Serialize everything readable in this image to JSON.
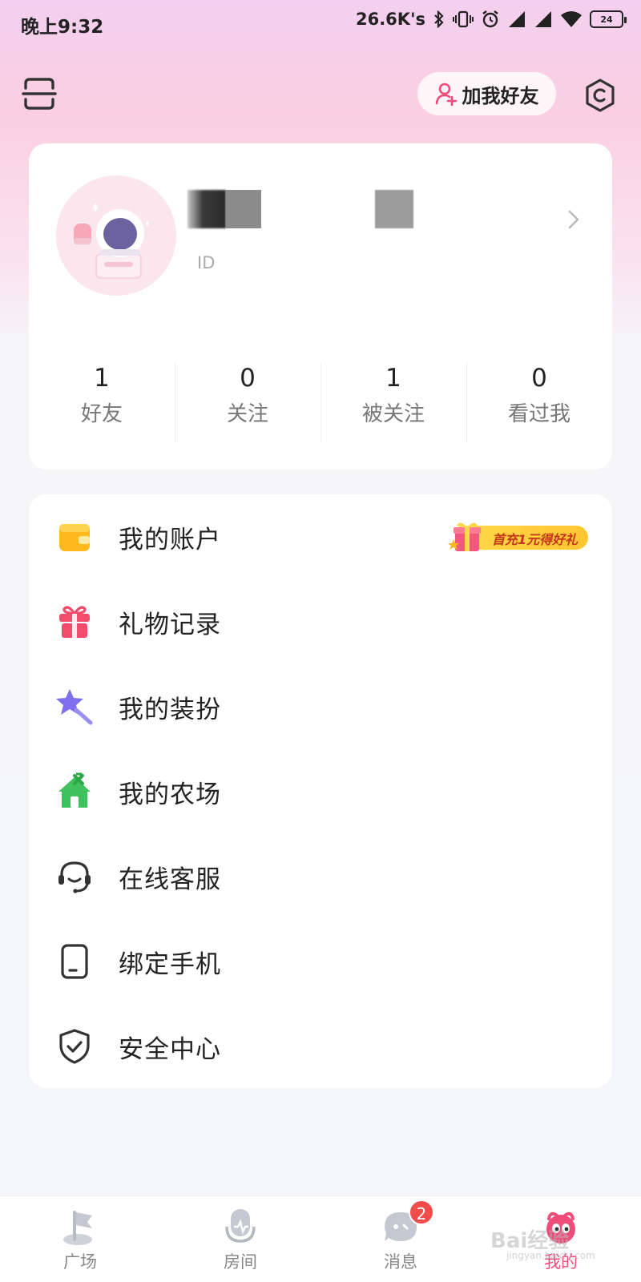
{
  "status_bar": {
    "time": "晚上9:32",
    "speed": "26.6K's",
    "battery": "24"
  },
  "header": {
    "add_friend_label": "加我好友"
  },
  "profile": {
    "id_label": "ID"
  },
  "stats": [
    {
      "value": "1",
      "label": "好友"
    },
    {
      "value": "0",
      "label": "关注"
    },
    {
      "value": "1",
      "label": "被关注"
    },
    {
      "value": "0",
      "label": "看过我"
    }
  ],
  "menu": [
    {
      "label": "我的账户",
      "icon": "wallet-icon",
      "badge": "首充1元得好礼"
    },
    {
      "label": "礼物记录",
      "icon": "gift-icon"
    },
    {
      "label": "我的装扮",
      "icon": "magic-wand-icon"
    },
    {
      "label": "我的农场",
      "icon": "farm-house-icon"
    },
    {
      "label": "在线客服",
      "icon": "headset-icon"
    },
    {
      "label": "绑定手机",
      "icon": "phone-icon"
    },
    {
      "label": "安全中心",
      "icon": "shield-icon"
    }
  ],
  "bottom_nav": [
    {
      "label": "广场",
      "icon": "flag-icon"
    },
    {
      "label": "房间",
      "icon": "microphone-icon"
    },
    {
      "label": "消息",
      "icon": "chat-icon",
      "badge": "2"
    },
    {
      "label": "我的",
      "icon": "profile-icon",
      "active": true
    }
  ],
  "watermark": {
    "text": "Bai经验",
    "sub": "jingyan.baidu.com"
  },
  "colors": {
    "accent": "#f04c7a",
    "badge_red": "#f24b4b",
    "promo_yellow": "#ffd84a"
  }
}
